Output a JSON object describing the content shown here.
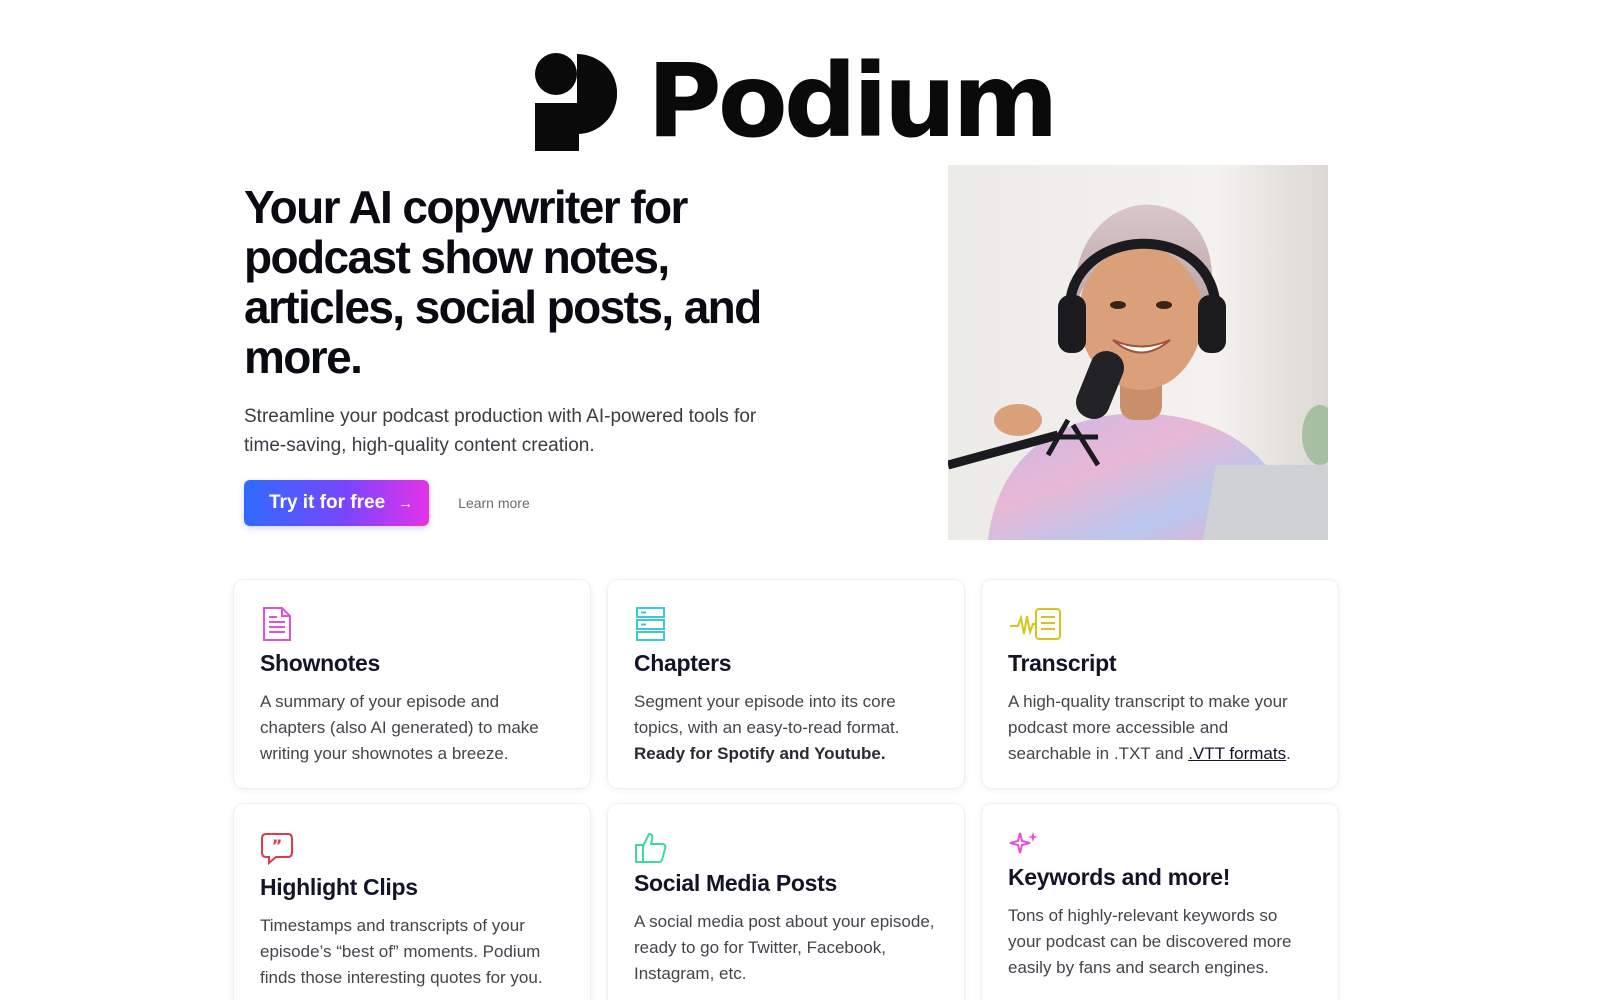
{
  "logo": {
    "wordmark": "Podium"
  },
  "hero": {
    "title": "Your AI copywriter for podcast show notes, articles, social posts, and more.",
    "subtitle": "Streamline your podcast production with AI-powered tools for time-saving, high-quality content creation.",
    "cta_primary": "Try it for free",
    "cta_primary_arrow": "→",
    "cta_secondary": "Learn more"
  },
  "features": [
    {
      "icon": "document-lines-icon",
      "title": "Shownotes",
      "text": "A summary of your episode and chapters (also AI generated) to make writing your shownotes a breeze."
    },
    {
      "icon": "stacked-rows-icon",
      "title": "Chapters",
      "text": "Segment your episode into its core topics, with an easy-to-read format.",
      "text_bold": "Ready for Spotify and Youtube."
    },
    {
      "icon": "waveform-document-icon",
      "title": "Transcript",
      "text": "A high-quality transcript to make your podcast more accessible and searchable in .TXT and ",
      "text_link": ".VTT formats",
      "text_end": "."
    },
    {
      "icon": "quote-bubble-icon",
      "title": "Highlight Clips",
      "text": "Timestamps and transcripts of your episode’s “best of” moments. Podium finds those interesting quotes for you."
    },
    {
      "icon": "thumbs-up-icon",
      "title": "Social Media Posts",
      "text": "A social media post about your episode, ready to go for Twitter, Facebook, Instagram, etc."
    },
    {
      "icon": "sparkles-icon",
      "title": "Keywords and more!",
      "text": "Tons of highly-relevant keywords so your podcast can be discovered more easily by fans and search engines."
    }
  ],
  "colors": {
    "brand_gradient_start": "#2f6bff",
    "brand_gradient_end": "#e532e8",
    "shownotes_icon": "#e34fd6",
    "chapters_icon": "#3cc9d6",
    "transcript_icon": "#d4c51a",
    "highlight_icon": "#e03a4a",
    "social_icon": "#42d6a0",
    "keywords_icon": "#e84fd9"
  }
}
